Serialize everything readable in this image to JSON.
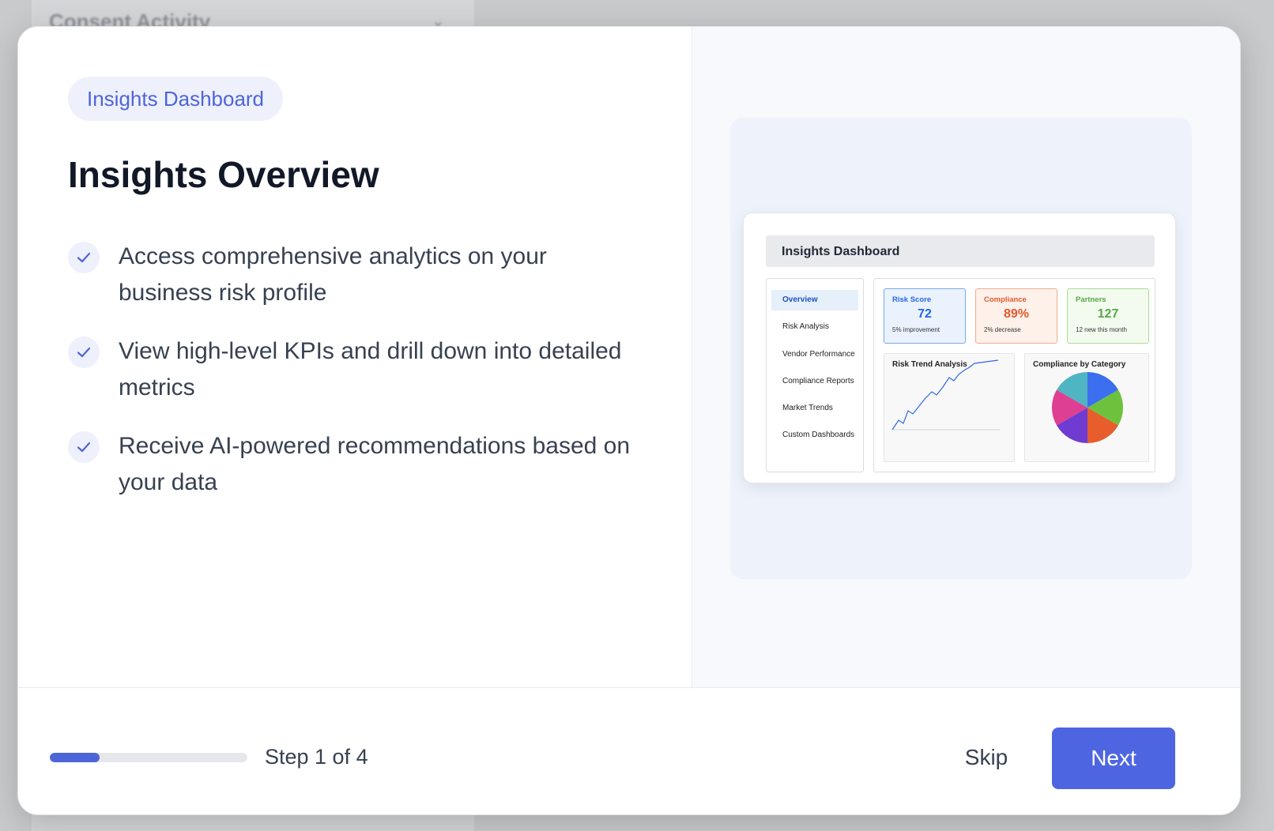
{
  "background": {
    "panel_title": "Consent Activity"
  },
  "modal": {
    "tag": "Insights Dashboard",
    "title": "Insights Overview",
    "features": [
      "Access comprehensive analytics on your business risk profile",
      "View high-level KPIs and drill down into detailed metrics",
      "Receive AI-powered recommendations based on your data"
    ],
    "check_icon": "check-icon",
    "preview": {
      "title": "Insights Dashboard",
      "nav": [
        "Overview",
        "Risk Analysis",
        "Vendor Performance",
        "Compliance Reports",
        "Market Trends",
        "Custom Dashboards"
      ],
      "kpis": [
        {
          "label": "Risk Score",
          "value": "72",
          "sub": "5% improvement",
          "color": "#2563eb",
          "bg": "#eaf3fd",
          "border": "#7aa7e8"
        },
        {
          "label": "Compliance",
          "value": "89%",
          "sub": "2% decrease",
          "color": "#e4572e",
          "bg": "#fdf1ea",
          "border": "#efae8d"
        },
        {
          "label": "Partners",
          "value": "127",
          "sub": "12 new this month",
          "color": "#56a845",
          "bg": "#f3fbef",
          "border": "#a9dd98"
        }
      ],
      "line_chart": {
        "title": "Risk Trend Analysis"
      },
      "pie_chart": {
        "title": "Compliance by Category",
        "slice_colors": [
          "#3b6ff0",
          "#6cc23c",
          "#e85d2c",
          "#6f3bd1",
          "#de3f92",
          "#4fb5c2"
        ]
      }
    }
  },
  "footer": {
    "progress": 0.25,
    "step_text": "Step 1 of 4",
    "skip_label": "Skip",
    "next_label": "Next"
  }
}
